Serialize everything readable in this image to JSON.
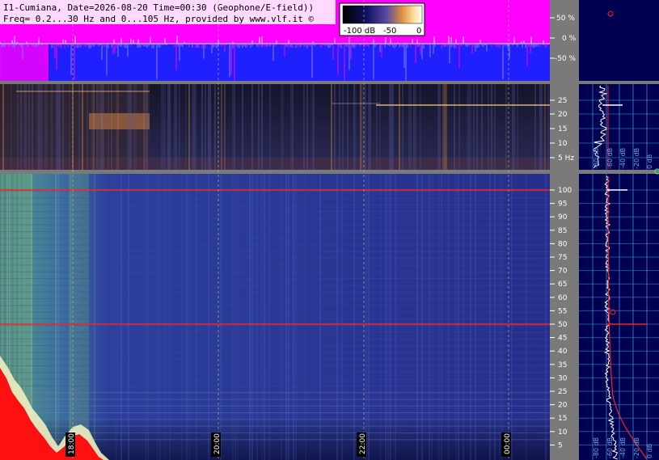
{
  "header": {
    "line1": "I1-Cumiana, Date=2026-08-20 Time=00:30 (Geophone/E-field))",
    "line2": "Freq= 0.2...30 Hz and 0...105 Hz, provided by www.vlf.it ©"
  },
  "colorbar": {
    "label_low": "-100 dB",
    "label_mid": "-50",
    "label_high": "0"
  },
  "top_scale": {
    "ticks": [
      "50 %",
      "0 %",
      "-50 %"
    ]
  },
  "mid_scale": {
    "unit_label": "5 Hz",
    "ticks": [
      "25",
      "20",
      "15",
      "10"
    ]
  },
  "main_scale": {
    "ticks": [
      "100",
      "95",
      "90",
      "85",
      "80",
      "75",
      "70",
      "65",
      "60",
      "55",
      "50",
      "45",
      "40",
      "35",
      "30",
      "25",
      "20",
      "15",
      "10",
      "5"
    ]
  },
  "time_labels": [
    "18:00",
    "20:00",
    "22:00",
    "00:00"
  ],
  "side_mid_labels": [
    "0 dB",
    "-20 dB",
    "-40 dB",
    "-60 dB",
    "-80 dB"
  ],
  "side_main_labels": [
    "0 dB",
    "-20 dB",
    "-40 dB",
    "-60 dB",
    "-80 dB"
  ],
  "colors": {
    "magenta": "#ff00ff",
    "blue": "#2020ff",
    "navy": "#000050",
    "red_trace": "#ff2020",
    "grid": "#3a8ad6"
  }
}
